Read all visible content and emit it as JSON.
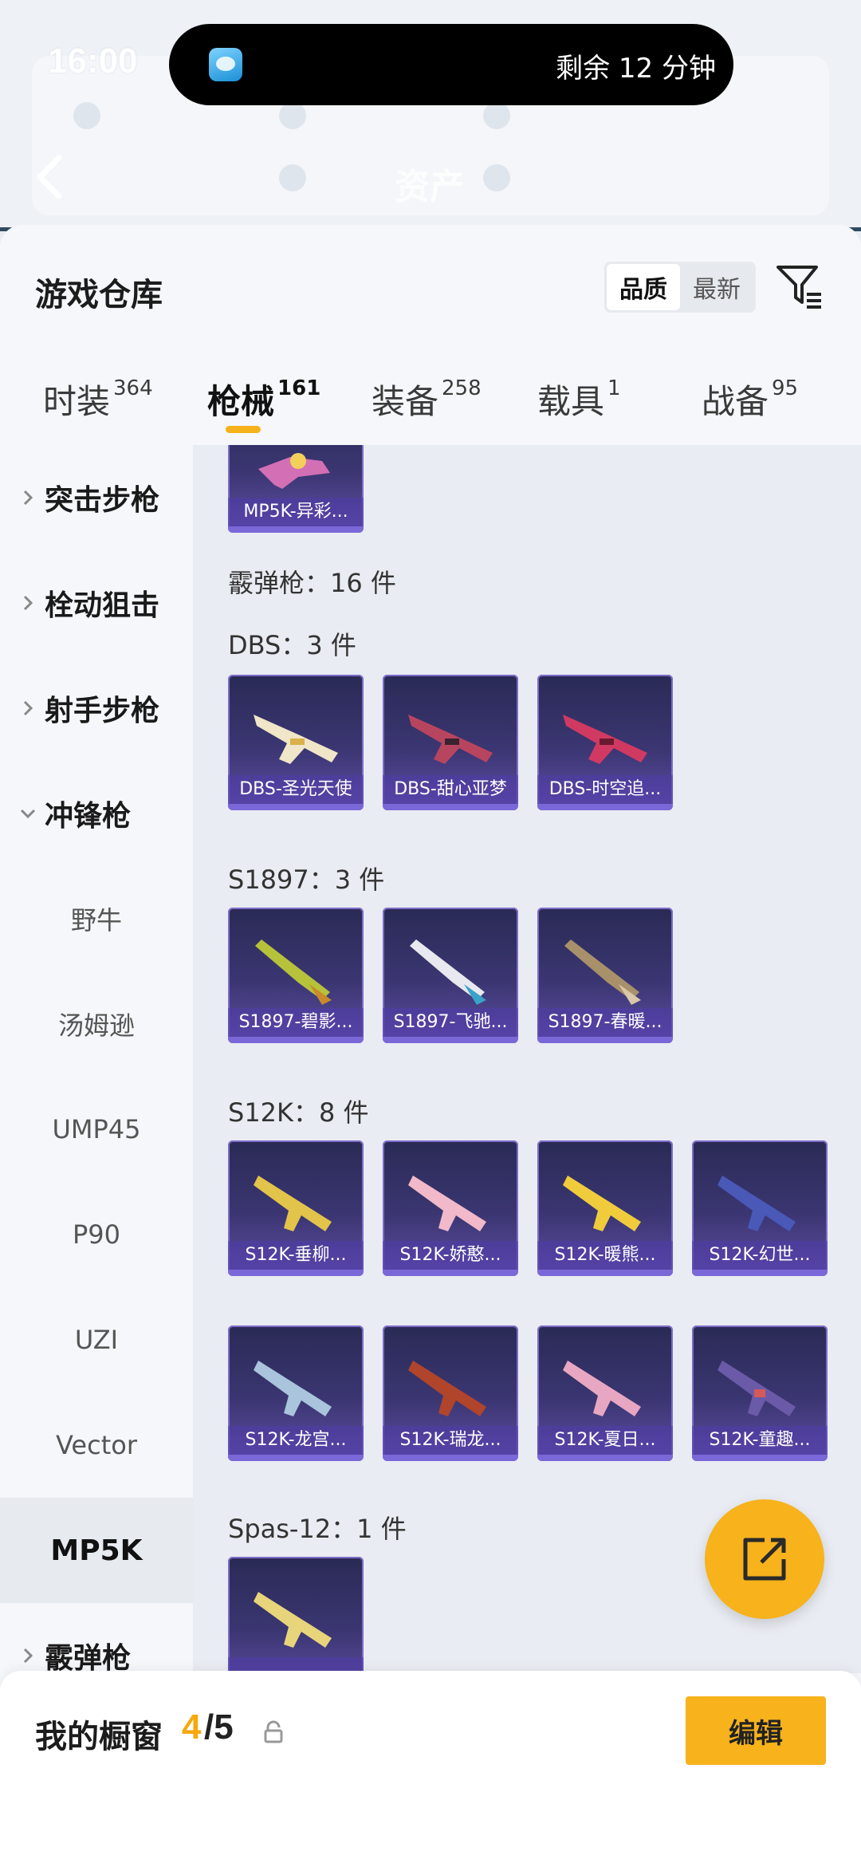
{
  "status": {
    "time": "16:00",
    "remaining": "剩余 12 分钟"
  },
  "header": {
    "title": "资产"
  },
  "sheet": {
    "title": "游戏仓库",
    "sort": [
      "品质",
      "最新"
    ],
    "sort_active": "品质"
  },
  "tabs": [
    {
      "label": "时装",
      "count": "364"
    },
    {
      "label": "枪械",
      "count": "161",
      "active": true
    },
    {
      "label": "装备",
      "count": "258"
    },
    {
      "label": "载具",
      "count": "1"
    },
    {
      "label": "战备",
      "count": "95"
    }
  ],
  "sidebar": {
    "groups": [
      "突击步枪",
      "栓动狙击",
      "射手步枪",
      "冲锋枪"
    ],
    "subs": [
      "野牛",
      "汤姆逊",
      "UMP45",
      "P90",
      "UZI",
      "Vector",
      "MP5K"
    ],
    "selected": "MP5K",
    "last_group": "霰弹枪"
  },
  "content": {
    "top_card": "MP5K-异彩...",
    "category": "霰弹枪：16 件",
    "sections": [
      {
        "label": "DBS：3 件",
        "items": [
          "DBS-圣光天使",
          "DBS-甜心亚梦",
          "DBS-时空追..."
        ]
      },
      {
        "label": "S1897：3 件",
        "items": [
          "S1897-碧影...",
          "S1897-飞驰...",
          "S1897-春暖..."
        ]
      },
      {
        "label": "S12K：8 件",
        "items": [
          "S12K-垂柳...",
          "S12K-娇憨...",
          "S12K-暖熊...",
          "S12K-幻世...",
          "S12K-龙宫...",
          "S12K-瑞龙...",
          "S12K-夏日...",
          "S12K-童趣..."
        ]
      },
      {
        "label": "Spas-12：1 件",
        "items": [
          ""
        ]
      }
    ]
  },
  "bottom": {
    "label": "我的橱窗",
    "count_now": "4",
    "count_total": "/5",
    "edit": "编辑"
  },
  "colors": {
    "accent": "#f7b21c",
    "card_bg": "#3b3672",
    "underline": "#f6b21a"
  }
}
